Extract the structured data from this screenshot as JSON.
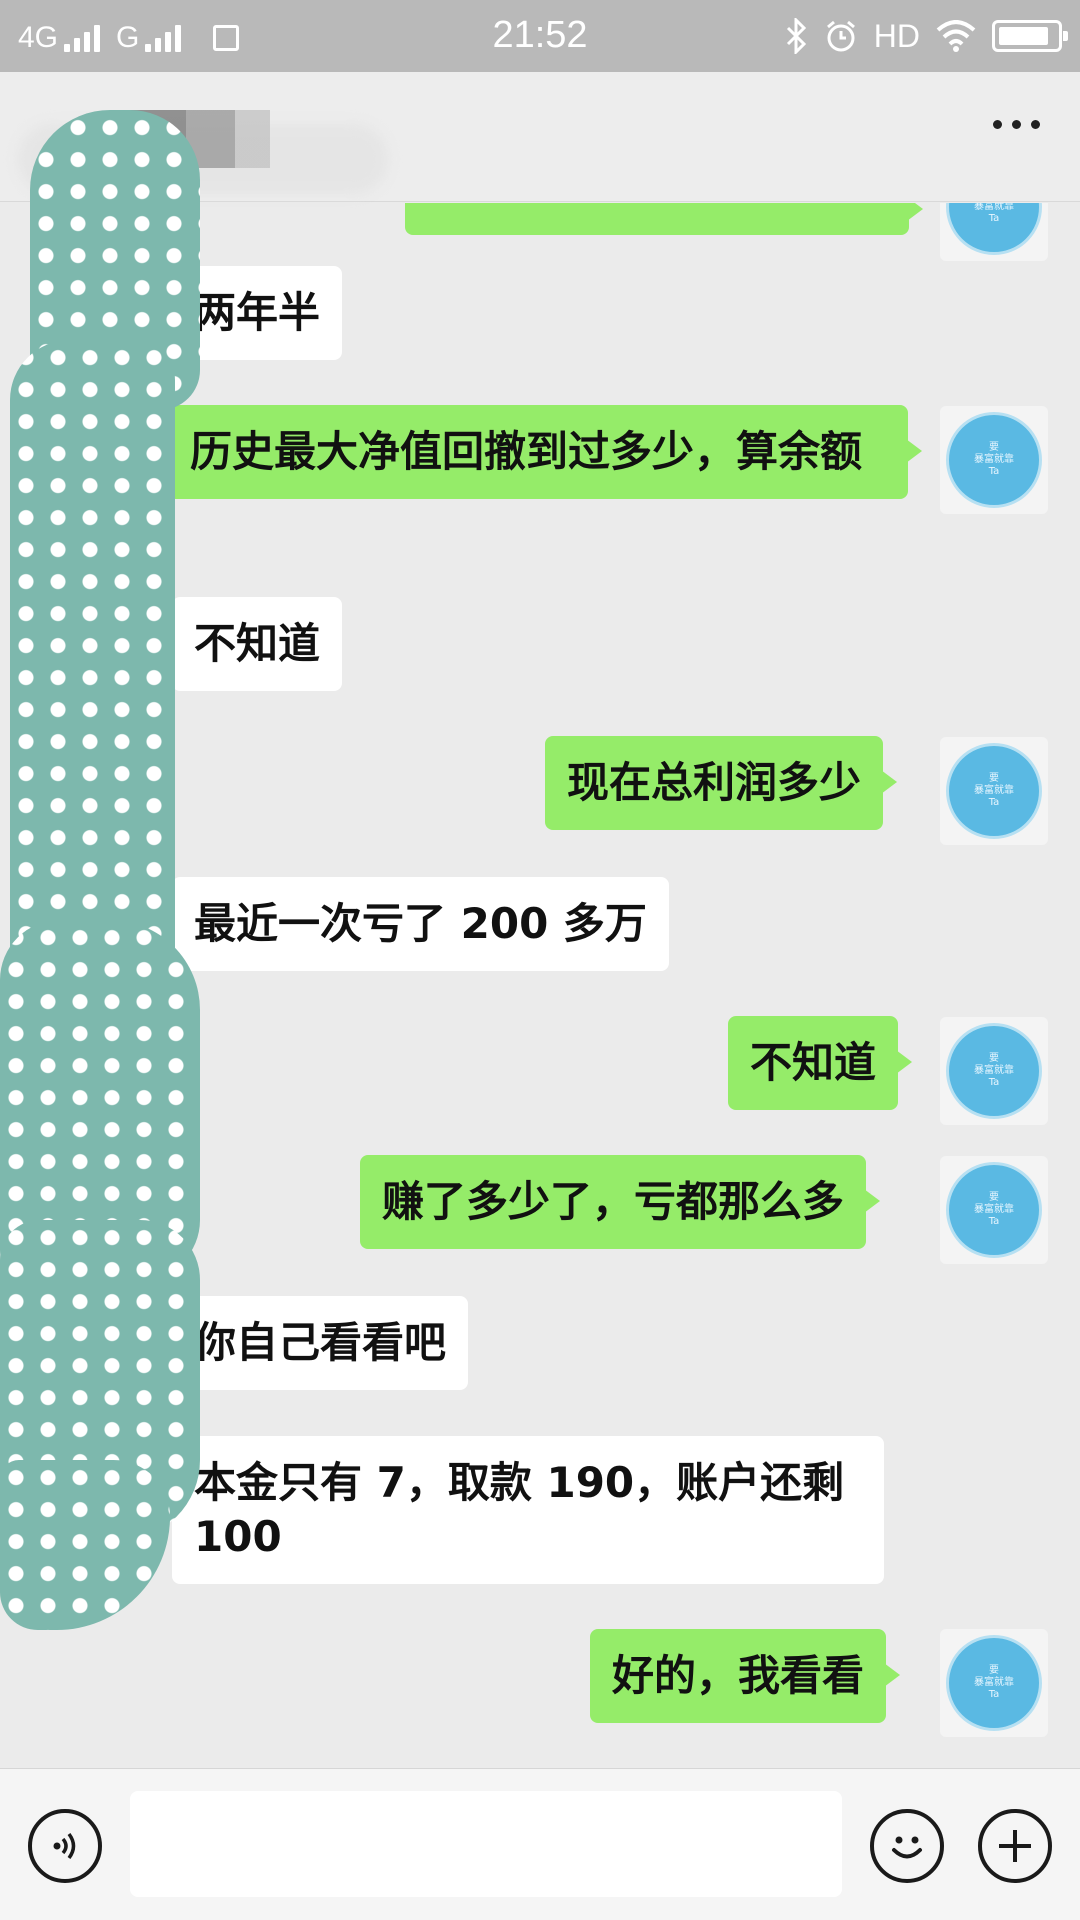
{
  "status_bar": {
    "network1": "4G",
    "network2": "G",
    "time": "21:52",
    "hd": "HD",
    "battery_level": 0.85
  },
  "header": {
    "more_icon": "more-horizontal-icon"
  },
  "messages": [
    {
      "side": "out",
      "text": ""
    },
    {
      "side": "in",
      "text": "两年半"
    },
    {
      "side": "out",
      "text": "历史最大净值回撤到过多少，算余额"
    },
    {
      "side": "in",
      "text": "不知道"
    },
    {
      "side": "out",
      "text": "现在总利润多少"
    },
    {
      "side": "in",
      "text": "最近一次亏了 200 多万"
    },
    {
      "side": "out",
      "text": "不知道"
    },
    {
      "side": "out",
      "text": "赚了多少了，亏都那么多"
    },
    {
      "side": "in",
      "text": "你自己看看吧"
    },
    {
      "side": "in",
      "text": "本金只有 7，取款 190，账户还剩 100"
    },
    {
      "side": "out",
      "text": "好的，我看看"
    }
  ],
  "avatar_text": {
    "line1": "要",
    "line2": "暴富就靠",
    "line3": "Ta"
  },
  "input_bar": {
    "voice_icon": "voice-icon",
    "emoji_icon": "emoji-icon",
    "plus_icon": "plus-icon"
  }
}
